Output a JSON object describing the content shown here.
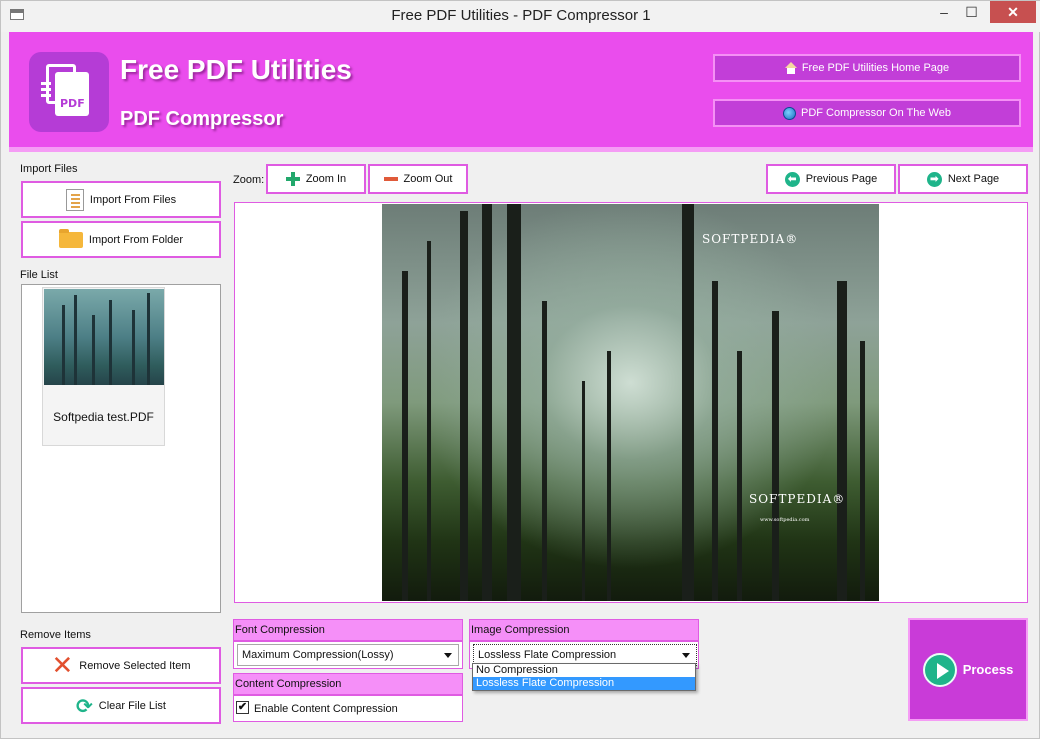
{
  "window": {
    "title": "Free PDF Utilities - PDF Compressor 1",
    "minimize_glyph": "–",
    "maximize_glyph": "☐",
    "close_glyph": "✕"
  },
  "header": {
    "logo_text": "PDF",
    "title": "Free PDF Utilities",
    "subtitle": "PDF Compressor",
    "home_button": "Free PDF Utilities Home Page",
    "web_button": "PDF Compressor On The Web",
    "brand_color": "#ea4ded"
  },
  "import": {
    "section_label": "Import Files",
    "from_files": "Import From Files",
    "from_folder": "Import From Folder"
  },
  "file_list": {
    "label": "File List",
    "items": [
      {
        "name": "Softpedia test.PDF"
      }
    ]
  },
  "remove": {
    "section_label": "Remove Items",
    "remove_selected": "Remove Selected Item",
    "clear_list": "Clear File List"
  },
  "zoom": {
    "label": "Zoom:",
    "zoom_in": "Zoom In",
    "zoom_out": "Zoom Out"
  },
  "paging": {
    "previous": "Previous Page",
    "next": "Next Page",
    "prev_glyph": "⬅",
    "next_glyph": "➡"
  },
  "preview": {
    "watermark_top": "SOFTPEDIA®",
    "watermark_bottom": "SOFTPEDIA®",
    "watermark_url": "www.softpedia.com"
  },
  "font_compression": {
    "label": "Font Compression",
    "selected": "Maximum Compression(Lossy)"
  },
  "content_compression": {
    "label": "Content Compression",
    "checkbox_label": "Enable Content Compression",
    "checked": true,
    "check_glyph": "✔"
  },
  "image_compression": {
    "label": "Image Compression",
    "selected": "Lossless Flate Compression",
    "options": [
      "No Compression",
      "Lossless Flate Compression"
    ],
    "highlighted_option": "Lossless Flate Compression"
  },
  "process": {
    "label": "Process"
  },
  "icons": {
    "remove": "✕",
    "clear": "⟳"
  }
}
